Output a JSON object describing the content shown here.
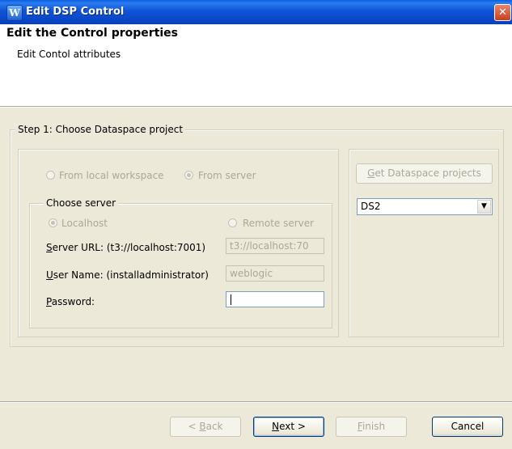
{
  "window": {
    "title": "Edit DSP Control",
    "icon": "app-logo-icon",
    "close_glyph": "✕"
  },
  "banner": {
    "title": "Edit the Control properties",
    "description": "Edit Contol attributes"
  },
  "step1": {
    "legend": "Step 1: Choose Dataspace project",
    "source": {
      "local_label": "From local workspace",
      "server_label": "From server",
      "selected": "server"
    },
    "choose_server": {
      "legend": "Choose server",
      "localhost_label": "Localhost",
      "remote_label": "Remote server",
      "selected": "localhost",
      "server_url_label_mn": "S",
      "server_url_label_rest": "erver URL: (t3://localhost:7001)",
      "server_url_value": "t3://localhost:70",
      "user_label_mn": "U",
      "user_label_rest": "ser Name: (installadministrator)",
      "user_value": "weblogic",
      "password_label_mn": "P",
      "password_label_rest": "assword:",
      "password_value": ""
    },
    "get_projects_mn": "G",
    "get_projects_rest": "et Dataspace projects",
    "project_select": {
      "selected": "DS2",
      "arrow": "▼"
    }
  },
  "footer": {
    "back_prefix": "< ",
    "back_mn": "B",
    "back_rest": "ack",
    "next_mn": "N",
    "next_rest": "ext >",
    "finish_mn": "F",
    "finish_rest": "inish",
    "cancel": "Cancel"
  },
  "colors": {
    "title_blue": "#0a48c8",
    "dialog_bg": "#ece9d8",
    "disabled_text": "#aca899",
    "close_red": "#c9401c"
  }
}
